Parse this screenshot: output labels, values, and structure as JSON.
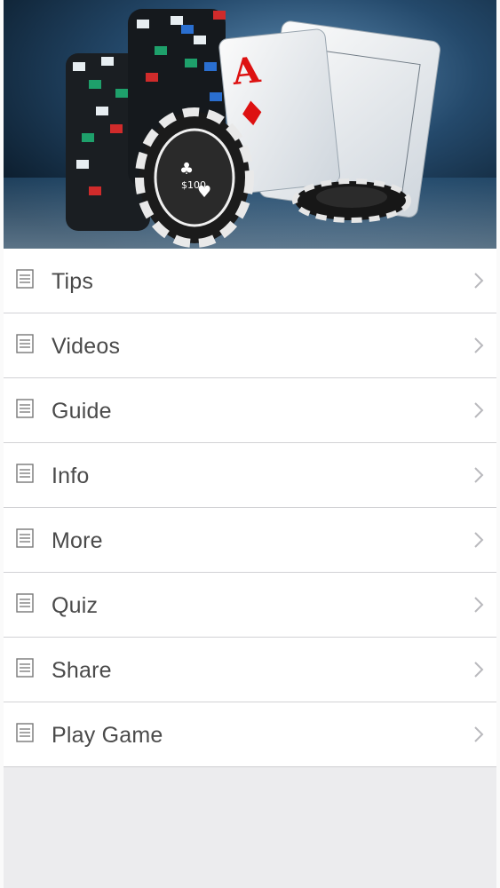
{
  "hero": {
    "icon": "poker-chips-and-aces-image"
  },
  "menu": {
    "items": [
      {
        "label": "Tips",
        "icon": "document-icon"
      },
      {
        "label": "Videos",
        "icon": "document-icon"
      },
      {
        "label": "Guide",
        "icon": "document-icon"
      },
      {
        "label": "Info",
        "icon": "document-icon"
      },
      {
        "label": "More",
        "icon": "document-icon"
      },
      {
        "label": "Quiz",
        "icon": "document-icon"
      },
      {
        "label": "Share",
        "icon": "document-icon"
      },
      {
        "label": "Play Game",
        "icon": "document-icon"
      }
    ]
  },
  "colors": {
    "row_text": "#4a4a4a",
    "divider": "#d2d2d5",
    "background": "#ececee",
    "chevron": "#b9b9bd"
  }
}
